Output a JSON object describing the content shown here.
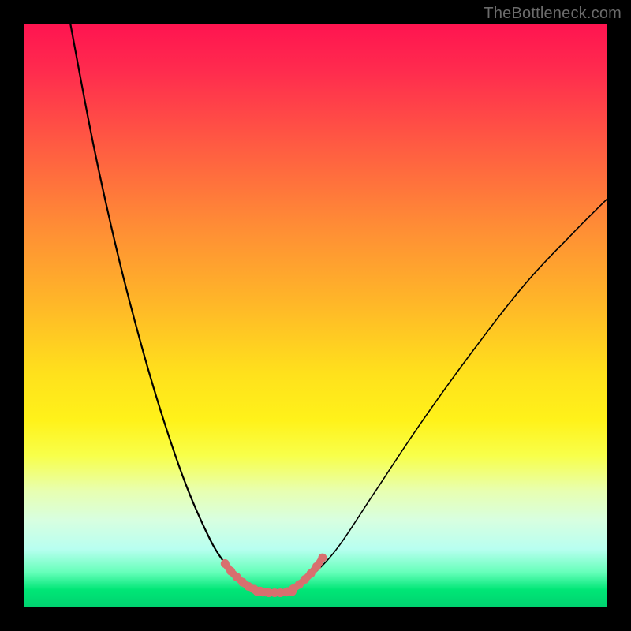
{
  "watermark": "TheBottleneck.com",
  "chart_data": {
    "type": "line",
    "title": "",
    "xlabel": "",
    "ylabel": "",
    "xlim": [
      0,
      1
    ],
    "ylim": [
      0,
      1
    ],
    "series": [
      {
        "name": "left-curve",
        "x": [
          0.08,
          0.12,
          0.16,
          0.2,
          0.24,
          0.28,
          0.32,
          0.345,
          0.36,
          0.375,
          0.39
        ],
        "y": [
          1.0,
          0.79,
          0.61,
          0.455,
          0.32,
          0.205,
          0.115,
          0.075,
          0.055,
          0.04,
          0.03
        ]
      },
      {
        "name": "right-curve",
        "x": [
          0.46,
          0.475,
          0.5,
          0.54,
          0.6,
          0.68,
          0.77,
          0.86,
          0.94,
          1.0
        ],
        "y": [
          0.03,
          0.04,
          0.06,
          0.105,
          0.195,
          0.315,
          0.44,
          0.555,
          0.64,
          0.7
        ]
      },
      {
        "name": "highlight-left",
        "x": [
          0.345,
          0.355,
          0.365,
          0.375,
          0.385,
          0.395,
          0.405,
          0.415
        ],
        "y": [
          0.075,
          0.062,
          0.052,
          0.043,
          0.036,
          0.031,
          0.028,
          0.026
        ]
      },
      {
        "name": "highlight-bottom",
        "x": [
          0.4,
          0.41,
          0.42,
          0.43,
          0.44,
          0.45,
          0.46
        ],
        "y": [
          0.027,
          0.026,
          0.025,
          0.025,
          0.025,
          0.026,
          0.027
        ]
      },
      {
        "name": "highlight-right",
        "x": [
          0.452,
          0.462,
          0.472,
          0.482,
          0.492,
          0.502,
          0.512
        ],
        "y": [
          0.027,
          0.032,
          0.039,
          0.048,
          0.058,
          0.07,
          0.085
        ]
      }
    ],
    "colors": {
      "curve": "#000000",
      "highlight": "#d86f6f",
      "highlight_fill": "#d86f6f"
    }
  }
}
